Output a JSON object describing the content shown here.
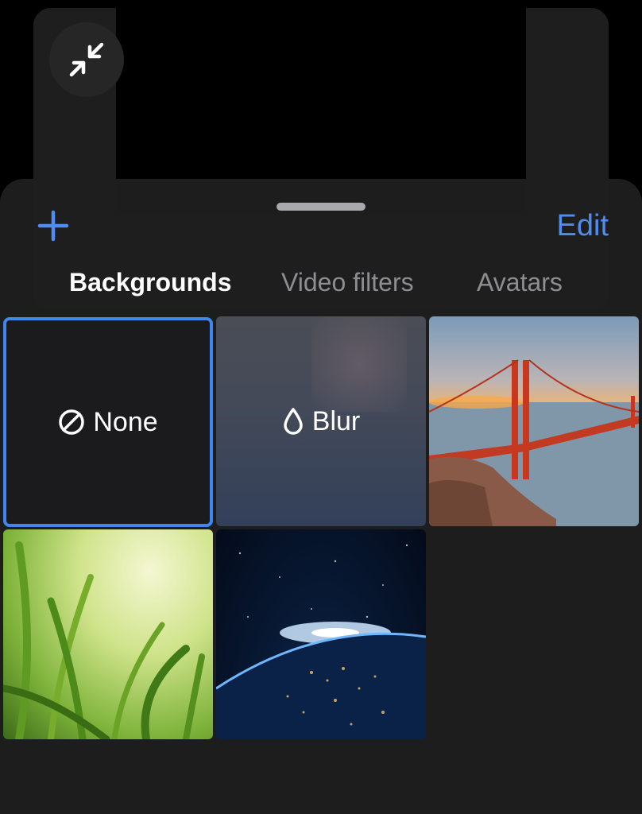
{
  "sheet": {
    "edit_label": "Edit",
    "tabs": [
      {
        "label": "Backgrounds",
        "active": true
      },
      {
        "label": "Video filters",
        "active": false
      },
      {
        "label": "Avatars",
        "active": false
      }
    ]
  },
  "tiles": {
    "none_label": "None",
    "blur_label": "Blur"
  },
  "icons": {
    "minimize": "minimize-arrows-icon",
    "add": "plus-icon",
    "none": "prohibited-icon",
    "blur": "drop-icon"
  },
  "colors": {
    "accent": "#4f8ef0",
    "selection_border": "#3f87ee",
    "sheet_bg": "#1e1e1e"
  }
}
